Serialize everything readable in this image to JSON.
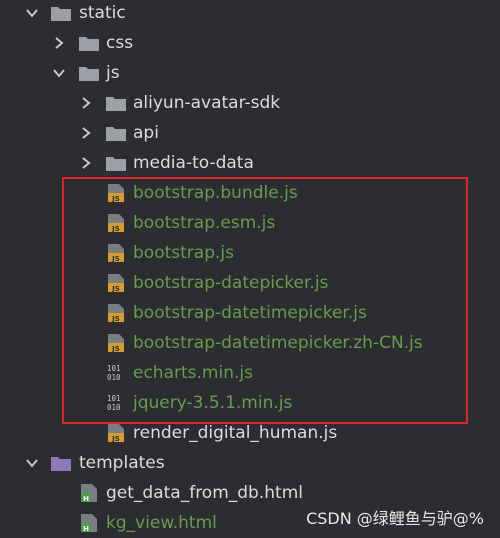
{
  "tree": {
    "static_label": "static",
    "css_label": "css",
    "js_label": "js",
    "aliyun_label": "aliyun-avatar-sdk",
    "api_label": "api",
    "media_label": "media-to-data",
    "files": [
      {
        "label": "bootstrap.bundle.js",
        "icon": "js-file-icon"
      },
      {
        "label": "bootstrap.esm.js",
        "icon": "js-file-icon"
      },
      {
        "label": "bootstrap.js",
        "icon": "js-file-icon"
      },
      {
        "label": "bootstrap-datepicker.js",
        "icon": "js-file-icon"
      },
      {
        "label": "bootstrap-datetimepicker.js",
        "icon": "js-file-icon"
      },
      {
        "label": "bootstrap-datetimepicker.zh-CN.js",
        "icon": "js-file-icon"
      },
      {
        "label": "echarts.min.js",
        "icon": "binary-file-icon"
      },
      {
        "label": "jquery-3.5.1.min.js",
        "icon": "binary-file-icon"
      }
    ],
    "render_label": "render_digital_human.js",
    "templates_label": "templates",
    "get_data_label": "get_data_from_db.html",
    "kg_view_label": "kg_view.html"
  },
  "watermark": "CSDN @绿鲤鱼与驴@%",
  "colors": {
    "background": "#2b2d30",
    "text": "#dcdcdc",
    "new_file_text": "#6a9a4e",
    "highlight_border": "#e0242b",
    "folder_gray": "#9aa0a6",
    "folder_purple": "#8b7ab8",
    "js_icon_gold": "#d39e2b"
  }
}
